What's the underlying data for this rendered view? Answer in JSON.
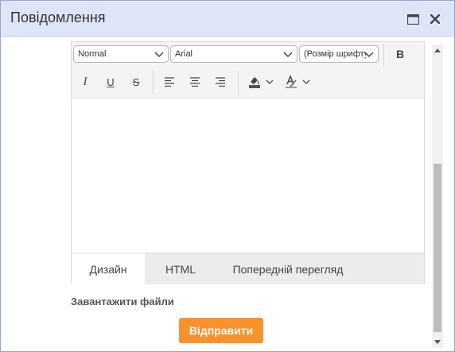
{
  "dialog": {
    "title": "Повідомлення"
  },
  "toolbar": {
    "format_value": "Normal",
    "font_value": "Arial",
    "size_value": "(Розмір шрифту)",
    "bold_label": "B",
    "italic_label": "I",
    "underline_label": "U",
    "strike_label": "S"
  },
  "tabs": [
    {
      "label": "Дизайн"
    },
    {
      "label": "HTML"
    },
    {
      "label": "Попередній перегляд"
    }
  ],
  "upload": {
    "label": "Завантажити файли"
  },
  "send_button": {
    "label": "Відправити"
  },
  "colors": {
    "titlebar": "#dfe5f8",
    "accent": "#f7922e"
  },
  "icons": [
    "maximize-icon",
    "close-icon",
    "chevron-down-icon",
    "align-left-icon",
    "align-center-icon",
    "align-right-icon",
    "highlight-color-icon",
    "font-color-icon",
    "scroll-up-icon",
    "scroll-down-icon"
  ]
}
